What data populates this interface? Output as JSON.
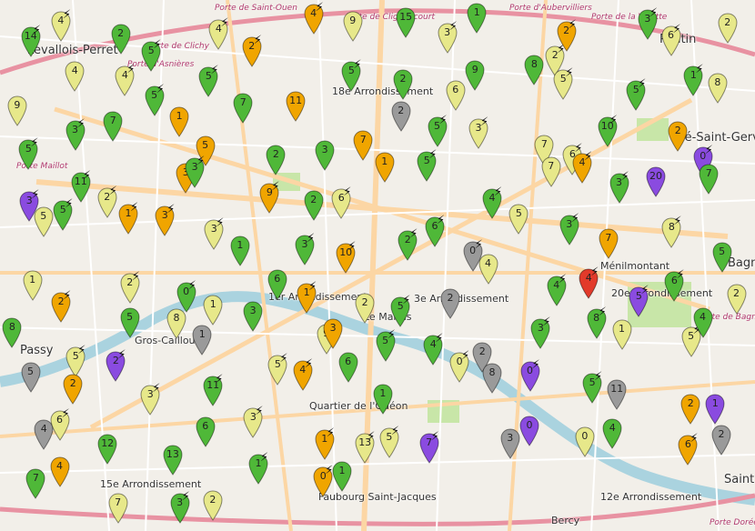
{
  "map": {
    "colors": {
      "green": "#4fb838",
      "yellow": "#e7e88a",
      "orange": "#f0a500",
      "gray": "#9a9a9a",
      "purple": "#8a4be0",
      "red": "#e23a2a",
      "river": "#aad3df",
      "road_major": "#fcd6a4",
      "road_minor": "#ffffff"
    },
    "labels": {
      "levallois": "Levallois-Perret",
      "pantin": "Pantin",
      "arr18": "18e Arrondissement",
      "pres_st_gervais": "Pré-Saint-Gervais",
      "arr1": "1er Arrondissement",
      "arr3": "3e Arrondissement",
      "marais": "Le Marais",
      "arr20": "20e Arrondissement",
      "menilmontant": "Ménilmontant",
      "passy": "Passy",
      "gros_caillou": "Gros-Caillou",
      "quartier_odeon": "Quartier de l'Odéon",
      "faubourg": "Faubourg Saint-Jacques",
      "arr12": "12e Arrondissement",
      "bercy": "Bercy",
      "arr15": "15e Arrondissement",
      "saint": "Saint",
      "bagnolet": "Bagnolet",
      "porte_clichy": "Porte de Clichy",
      "porte_asnieres": "Porte d'Asnières",
      "porte_maillot": "Porte Maillot",
      "porte_ouen": "Porte de Saint-Ouen",
      "porte_clignancourt": "Porte de Clignancourt",
      "porte_aubervilliers": "Porte d'Aubervilliers",
      "porte_villette": "Porte de la Villette",
      "porte_doree": "Porte Dorée",
      "porte_bagnolet": "Porte de Bagnolet"
    },
    "markers": [
      {
        "c": "green",
        "t": "14",
        "b": true
      },
      {
        "c": "yellow",
        "t": "4",
        "b": true
      },
      {
        "c": "green",
        "t": "2",
        "b": false
      },
      {
        "c": "green",
        "t": "5",
        "b": true
      },
      {
        "c": "yellow",
        "t": "4",
        "b": true
      },
      {
        "c": "orange",
        "t": "2",
        "b": true
      },
      {
        "c": "orange",
        "t": "4",
        "b": true
      },
      {
        "c": "yellow",
        "t": "9",
        "b": false
      },
      {
        "c": "green",
        "t": "15",
        "b": false
      },
      {
        "c": "yellow",
        "t": "3",
        "b": true
      },
      {
        "c": "green",
        "t": "1",
        "b": false
      },
      {
        "c": "yellow",
        "t": "2",
        "b": true
      },
      {
        "c": "orange",
        "t": "2",
        "b": true
      },
      {
        "c": "green",
        "t": "3",
        "b": true
      },
      {
        "c": "yellow",
        "t": "6",
        "b": true
      },
      {
        "c": "yellow",
        "t": "2",
        "b": false
      },
      {
        "c": "yellow",
        "t": "9",
        "b": false
      },
      {
        "c": "yellow",
        "t": "4",
        "b": false
      },
      {
        "c": "yellow",
        "t": "4",
        "b": true
      },
      {
        "c": "green",
        "t": "5",
        "b": true
      },
      {
        "c": "green",
        "t": "5",
        "b": true
      },
      {
        "c": "green",
        "t": "7",
        "b": false
      },
      {
        "c": "orange",
        "t": "11",
        "b": false
      },
      {
        "c": "green",
        "t": "5",
        "b": true
      },
      {
        "c": "green",
        "t": "2",
        "b": false
      },
      {
        "c": "yellow",
        "t": "6",
        "b": false
      },
      {
        "c": "green",
        "t": "9",
        "b": false
      },
      {
        "c": "green",
        "t": "8",
        "b": false
      },
      {
        "c": "yellow",
        "t": "5",
        "b": true
      },
      {
        "c": "green",
        "t": "5",
        "b": true
      },
      {
        "c": "green",
        "t": "1",
        "b": true
      },
      {
        "c": "yellow",
        "t": "8",
        "b": false
      },
      {
        "c": "green",
        "t": "5",
        "b": true
      },
      {
        "c": "green",
        "t": "3",
        "b": true
      },
      {
        "c": "green",
        "t": "7",
        "b": false
      },
      {
        "c": "orange",
        "t": "1",
        "b": false
      },
      {
        "c": "orange",
        "t": "5",
        "b": false
      },
      {
        "c": "green",
        "t": "2",
        "b": false
      },
      {
        "c": "green",
        "t": "3",
        "b": false
      },
      {
        "c": "orange",
        "t": "7",
        "b": false
      },
      {
        "c": "gray",
        "t": "2",
        "b": false
      },
      {
        "c": "green",
        "t": "5",
        "b": true
      },
      {
        "c": "yellow",
        "t": "3",
        "b": true
      },
      {
        "c": "yellow",
        "t": "7",
        "b": false
      },
      {
        "c": "yellow",
        "t": "6",
        "b": true
      },
      {
        "c": "green",
        "t": "10",
        "b": true
      },
      {
        "c": "orange",
        "t": "2",
        "b": false
      },
      {
        "c": "purple",
        "t": "0",
        "b": true
      },
      {
        "c": "purple",
        "t": "3",
        "b": true
      },
      {
        "c": "green",
        "t": "11",
        "b": true
      },
      {
        "c": "yellow",
        "t": "2",
        "b": true
      },
      {
        "c": "orange",
        "t": "3",
        "b": false
      },
      {
        "c": "green",
        "t": "3",
        "b": true
      },
      {
        "c": "orange",
        "t": "9",
        "b": true
      },
      {
        "c": "green",
        "t": "2",
        "b": false
      },
      {
        "c": "yellow",
        "t": "6",
        "b": true
      },
      {
        "c": "orange",
        "t": "1",
        "b": false
      },
      {
        "c": "green",
        "t": "5",
        "b": true
      },
      {
        "c": "green",
        "t": "4",
        "b": true
      },
      {
        "c": "yellow",
        "t": "7",
        "b": false
      },
      {
        "c": "orange",
        "t": "4",
        "b": true
      },
      {
        "c": "green",
        "t": "3",
        "b": true
      },
      {
        "c": "purple",
        "t": "20",
        "b": false
      },
      {
        "c": "green",
        "t": "7",
        "b": false
      },
      {
        "c": "yellow",
        "t": "5",
        "b": false
      },
      {
        "c": "green",
        "t": "5",
        "b": true
      },
      {
        "c": "orange",
        "t": "1",
        "b": true
      },
      {
        "c": "orange",
        "t": "3",
        "b": true
      },
      {
        "c": "yellow",
        "t": "3",
        "b": true
      },
      {
        "c": "green",
        "t": "1",
        "b": false
      },
      {
        "c": "green",
        "t": "3",
        "b": true
      },
      {
        "c": "orange",
        "t": "10",
        "b": true
      },
      {
        "c": "green",
        "t": "2",
        "b": true
      },
      {
        "c": "green",
        "t": "6",
        "b": true
      },
      {
        "c": "gray",
        "t": "0",
        "b": true
      },
      {
        "c": "yellow",
        "t": "5",
        "b": false
      },
      {
        "c": "green",
        "t": "3",
        "b": true
      },
      {
        "c": "orange",
        "t": "7",
        "b": false
      },
      {
        "c": "yellow",
        "t": "8",
        "b": true
      },
      {
        "c": "green",
        "t": "5",
        "b": false
      },
      {
        "c": "yellow",
        "t": "1",
        "b": false
      },
      {
        "c": "orange",
        "t": "2",
        "b": true
      },
      {
        "c": "yellow",
        "t": "2",
        "b": true
      },
      {
        "c": "green",
        "t": "0",
        "b": true
      },
      {
        "c": "yellow",
        "t": "1",
        "b": false
      },
      {
        "c": "green",
        "t": "6",
        "b": false
      },
      {
        "c": "orange",
        "t": "1",
        "b": true
      },
      {
        "c": "yellow",
        "t": "2",
        "b": false
      },
      {
        "c": "green",
        "t": "5",
        "b": true
      },
      {
        "c": "gray",
        "t": "2",
        "b": false
      },
      {
        "c": "yellow",
        "t": "4",
        "b": false
      },
      {
        "c": "green",
        "t": "4",
        "b": true
      },
      {
        "c": "red",
        "t": "4",
        "b": true
      },
      {
        "c": "purple",
        "t": "5",
        "b": true
      },
      {
        "c": "green",
        "t": "6",
        "b": true
      },
      {
        "c": "yellow",
        "t": "2",
        "b": false
      },
      {
        "c": "green",
        "t": "8",
        "b": false
      },
      {
        "c": "yellow",
        "t": "5",
        "b": true
      },
      {
        "c": "green",
        "t": "5",
        "b": false
      },
      {
        "c": "yellow",
        "t": "8",
        "b": false
      },
      {
        "c": "gray",
        "t": "1",
        "b": false
      },
      {
        "c": "green",
        "t": "3",
        "b": false
      },
      {
        "c": "yellow",
        "t": "9",
        "b": false
      },
      {
        "c": "orange",
        "t": "3",
        "b": false
      },
      {
        "c": "green",
        "t": "5",
        "b": true
      },
      {
        "c": "green",
        "t": "4",
        "b": true
      },
      {
        "c": "gray",
        "t": "2",
        "b": false
      },
      {
        "c": "green",
        "t": "3",
        "b": true
      },
      {
        "c": "green",
        "t": "8",
        "b": true
      },
      {
        "c": "yellow",
        "t": "1",
        "b": false
      },
      {
        "c": "yellow",
        "t": "5",
        "b": true
      },
      {
        "c": "green",
        "t": "4",
        "b": false
      },
      {
        "c": "gray",
        "t": "5",
        "b": false
      },
      {
        "c": "orange",
        "t": "2",
        "b": false
      },
      {
        "c": "purple",
        "t": "2",
        "b": true
      },
      {
        "c": "yellow",
        "t": "3",
        "b": true
      },
      {
        "c": "green",
        "t": "11",
        "b": true
      },
      {
        "c": "yellow",
        "t": "5",
        "b": true
      },
      {
        "c": "orange",
        "t": "4",
        "b": true
      },
      {
        "c": "green",
        "t": "6",
        "b": false
      },
      {
        "c": "green",
        "t": "1",
        "b": false
      },
      {
        "c": "yellow",
        "t": "0",
        "b": true
      },
      {
        "c": "gray",
        "t": "8",
        "b": false
      },
      {
        "c": "purple",
        "t": "0",
        "b": true
      },
      {
        "c": "green",
        "t": "5",
        "b": true
      },
      {
        "c": "gray",
        "t": "11",
        "b": false
      },
      {
        "c": "orange",
        "t": "2",
        "b": false
      },
      {
        "c": "purple",
        "t": "1",
        "b": false
      },
      {
        "c": "gray",
        "t": "4",
        "b": false
      },
      {
        "c": "yellow",
        "t": "6",
        "b": true
      },
      {
        "c": "green",
        "t": "12",
        "b": false
      },
      {
        "c": "green",
        "t": "13",
        "b": false
      },
      {
        "c": "green",
        "t": "6",
        "b": false
      },
      {
        "c": "yellow",
        "t": "3",
        "b": true
      },
      {
        "c": "orange",
        "t": "1",
        "b": true
      },
      {
        "c": "yellow",
        "t": "13",
        "b": true
      },
      {
        "c": "yellow",
        "t": "5",
        "b": true
      },
      {
        "c": "purple",
        "t": "7",
        "b": true
      },
      {
        "c": "gray",
        "t": "3",
        "b": false
      },
      {
        "c": "purple",
        "t": "0",
        "b": false
      },
      {
        "c": "yellow",
        "t": "0",
        "b": false
      },
      {
        "c": "green",
        "t": "4",
        "b": false
      },
      {
        "c": "orange",
        "t": "6",
        "b": true
      },
      {
        "c": "gray",
        "t": "2",
        "b": false
      },
      {
        "c": "green",
        "t": "7",
        "b": false
      },
      {
        "c": "orange",
        "t": "4",
        "b": false
      },
      {
        "c": "yellow",
        "t": "7",
        "b": false
      },
      {
        "c": "green",
        "t": "3",
        "b": true
      },
      {
        "c": "yellow",
        "t": "2",
        "b": false
      },
      {
        "c": "green",
        "t": "1",
        "b": true
      },
      {
        "c": "orange",
        "t": "0",
        "b": true
      },
      {
        "c": "green",
        "t": "1",
        "b": false
      }
    ]
  }
}
